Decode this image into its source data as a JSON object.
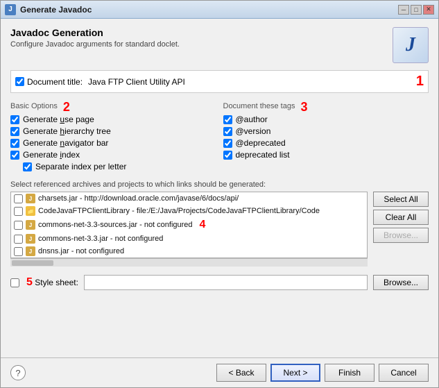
{
  "window": {
    "title": "Generate Javadoc"
  },
  "header": {
    "title": "Javadoc Generation",
    "subtitle": "Configure Javadoc arguments for standard doclet.",
    "icon_letter": "J",
    "number1": "1"
  },
  "doc_title": {
    "checkbox_checked": true,
    "label": "Document title:",
    "value": "Java FTP Client Utility API"
  },
  "basic_options": {
    "title": "Basic Options",
    "number": "2",
    "items": [
      {
        "label": "Generate use page",
        "checked": true,
        "underline_start": 9,
        "underline_end": 11
      },
      {
        "label": "Generate hierarchy tree",
        "checked": true,
        "underline_start": 9,
        "underline_end": 17
      },
      {
        "label": "Generate navigator bar",
        "checked": true,
        "underline_start": 9,
        "underline_end": 17
      },
      {
        "label": "Generate index",
        "checked": true,
        "underline_start": 9,
        "underline_end": 14
      }
    ],
    "sub_item": {
      "label": "Separate index per letter",
      "checked": true
    }
  },
  "document_tags": {
    "title": "Document these tags",
    "number": "3",
    "items": [
      {
        "label": "@author",
        "checked": true
      },
      {
        "label": "@version",
        "checked": true
      },
      {
        "label": "@deprecated",
        "checked": true
      },
      {
        "label": "deprecated list",
        "checked": true
      }
    ]
  },
  "archives": {
    "label": "Select referenced archives and projects to which links should be generated:",
    "number": "4",
    "items": [
      {
        "checked": false,
        "type": "jar",
        "text": "charsets.jar - http://download.oracle.com/javase/6/docs/api/"
      },
      {
        "checked": false,
        "type": "folder",
        "text": "CodeJavaFTPClientLibrary - file:/E:/Java/Projects/CodeJavaFTPClientLibrary/Code"
      },
      {
        "checked": false,
        "type": "jar",
        "text": "commons-net-3.3-sources.jar - not configured"
      },
      {
        "checked": false,
        "type": "jar",
        "text": "commons-net-3.3.jar - not configured"
      },
      {
        "checked": false,
        "type": "jar",
        "text": "dnsns.jar - not configured"
      }
    ],
    "buttons": {
      "select_all": "Select All",
      "clear_all": "Clear All",
      "browse": "Browse..."
    }
  },
  "stylesheet": {
    "label": "Style sheet:",
    "number": "5",
    "value": "",
    "placeholder": "",
    "checkbox_checked": false,
    "browse_label": "Browse..."
  },
  "bottom": {
    "back_label": "< Back",
    "next_label": "Next >",
    "finish_label": "Finish",
    "cancel_label": "Cancel"
  }
}
